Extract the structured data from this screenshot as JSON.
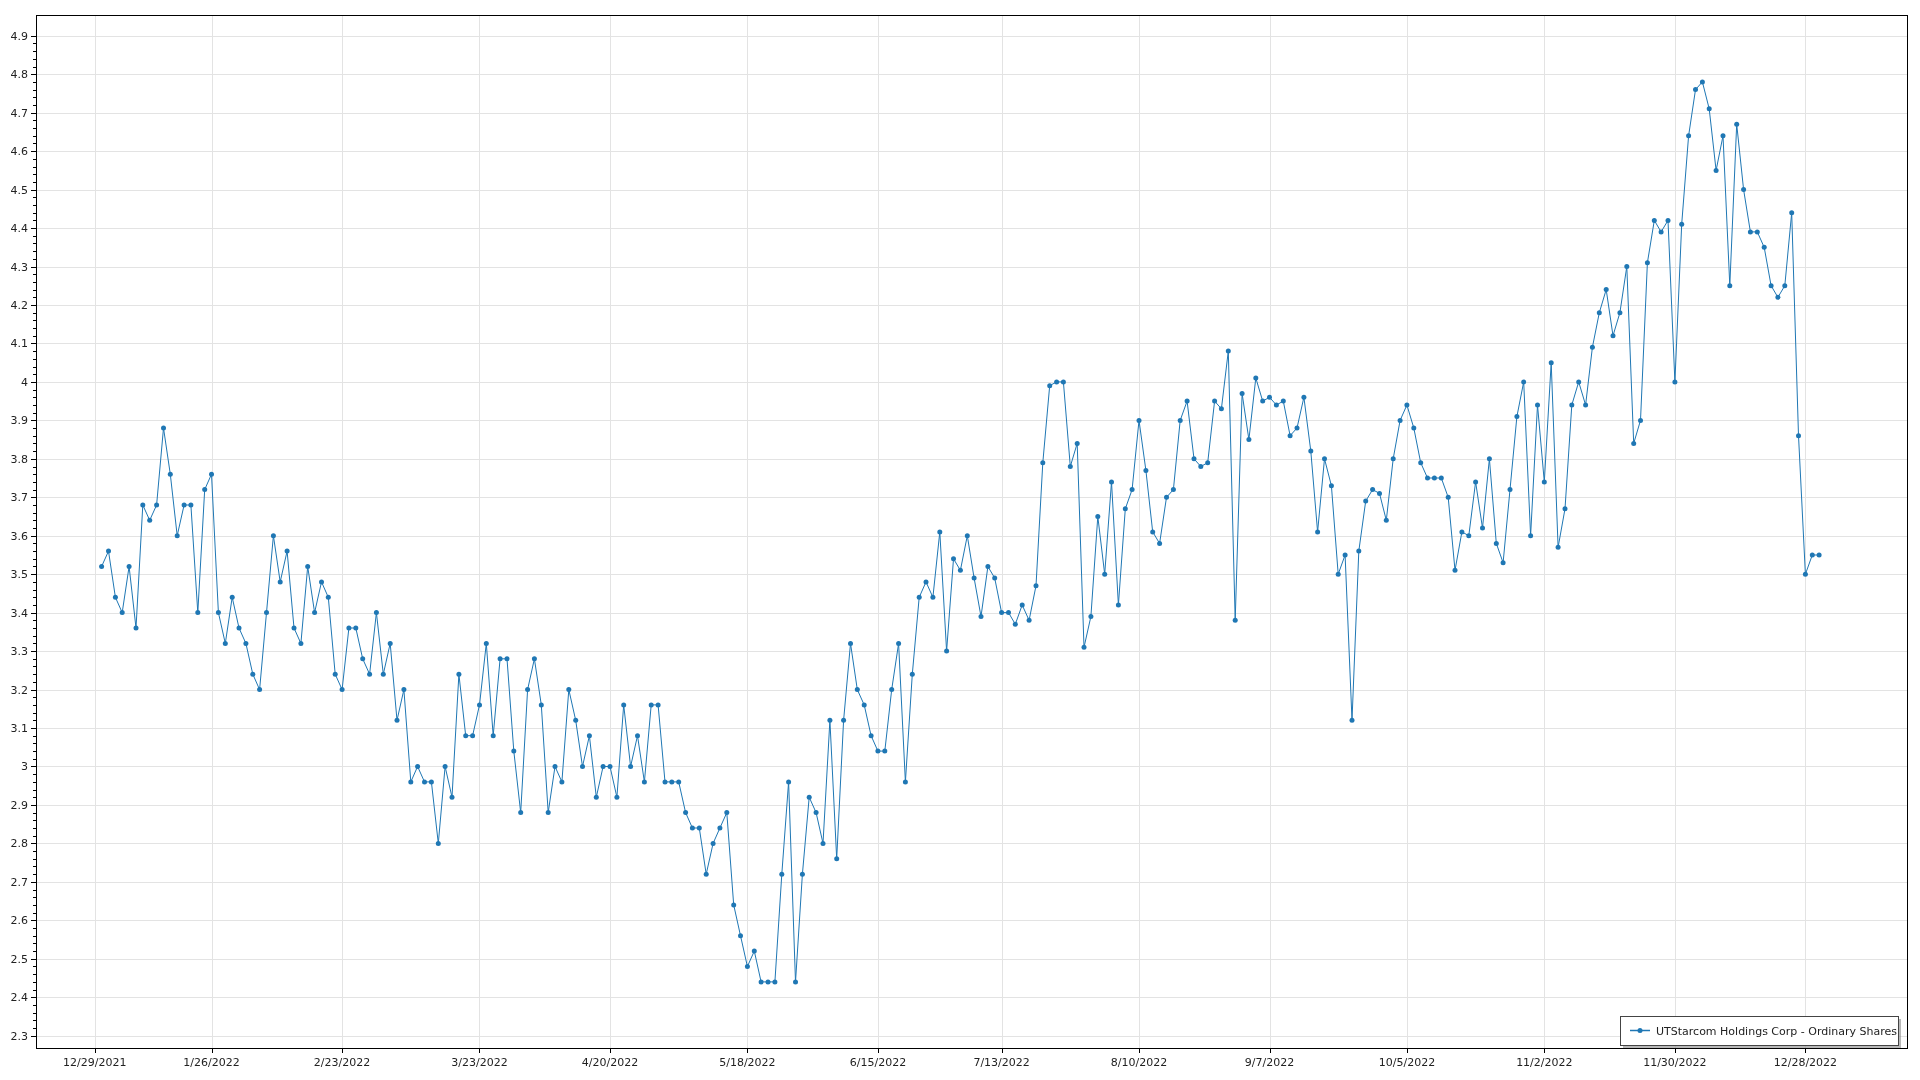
{
  "chart": {
    "chart_data": {
      "type": "line",
      "grid": true,
      "categories": [
        "12/29/2021",
        null,
        null,
        null,
        null,
        null,
        null,
        null,
        null,
        null,
        null,
        null,
        null,
        null,
        null,
        null,
        null,
        "1/26/2022",
        null,
        null,
        null,
        null,
        null,
        null,
        null,
        null,
        null,
        null,
        null,
        null,
        null,
        null,
        null,
        null,
        null,
        null,
        "2/23/2022",
        null,
        null,
        null,
        null,
        null,
        null,
        null,
        null,
        null,
        null,
        null,
        null,
        null,
        null,
        null,
        null,
        null,
        null,
        null,
        "3/23/2022",
        null,
        null,
        null,
        null,
        null,
        null,
        null,
        null,
        null,
        null,
        null,
        null,
        null,
        null,
        null,
        null,
        null,
        null,
        "4/20/2022",
        null,
        null,
        null,
        null,
        null,
        null,
        null,
        null,
        null,
        null,
        null,
        null,
        null,
        null,
        null,
        null,
        null,
        null,
        null,
        "5/18/2022",
        null,
        null,
        null,
        null,
        null,
        null,
        null,
        null,
        null,
        null,
        null,
        null,
        null,
        null,
        null,
        null,
        null,
        null,
        "6/15/2022",
        null,
        null,
        null,
        null,
        null,
        null,
        null,
        null,
        null,
        null,
        null,
        null,
        null,
        null,
        null,
        null,
        null,
        "7/13/2022",
        null,
        null,
        null,
        null,
        null,
        null,
        null,
        null,
        null,
        null,
        null,
        null,
        null,
        null,
        null,
        null,
        null,
        null,
        null,
        "8/10/2022",
        null,
        null,
        null,
        null,
        null,
        null,
        null,
        null,
        null,
        null,
        null,
        null,
        null,
        null,
        null,
        null,
        null,
        null,
        "9/7/2022",
        null,
        null,
        null,
        null,
        null,
        null,
        null,
        null,
        null,
        null,
        null,
        null,
        null,
        null,
        null,
        null,
        null,
        null,
        null,
        "10/5/2022",
        null,
        null,
        null,
        null,
        null,
        null,
        null,
        null,
        null,
        null,
        null,
        null,
        null,
        null,
        null,
        null,
        null,
        null,
        null,
        "11/2/2022",
        null,
        null,
        null,
        null,
        null,
        null,
        null,
        null,
        null,
        null,
        null,
        null,
        null,
        null,
        null,
        null,
        null,
        null,
        "11/30/2022",
        null,
        null,
        null,
        null,
        null,
        null,
        null,
        null,
        null,
        null,
        null,
        null,
        null,
        null,
        null,
        null,
        null,
        null,
        "12/28/2022",
        null,
        null
      ],
      "series": [
        {
          "name": "UTStarcom Holdings Corp - Ordinary Shares",
          "color": "#1f77b4",
          "values": [
            null,
            3.52,
            3.56,
            3.44,
            3.4,
            3.52,
            3.36,
            3.68,
            3.64,
            3.68,
            3.88,
            3.76,
            3.6,
            3.68,
            3.68,
            3.4,
            3.72,
            3.76,
            3.4,
            3.32,
            3.44,
            3.36,
            3.32,
            3.24,
            3.2,
            3.4,
            3.6,
            3.48,
            3.56,
            3.36,
            3.32,
            3.52,
            3.4,
            3.48,
            3.44,
            3.24,
            3.2,
            3.36,
            3.36,
            3.28,
            3.24,
            3.4,
            3.24,
            3.32,
            3.12,
            3.2,
            2.96,
            3.0,
            2.96,
            2.96,
            2.8,
            3.0,
            2.92,
            3.24,
            3.08,
            3.08,
            3.16,
            3.32,
            3.08,
            3.28,
            3.28,
            3.04,
            2.88,
            3.2,
            3.28,
            3.16,
            2.88,
            3.0,
            2.96,
            3.2,
            3.12,
            3.0,
            3.08,
            2.92,
            3.0,
            3.0,
            2.92,
            3.16,
            3.0,
            3.08,
            2.96,
            3.16,
            3.16,
            2.96,
            2.96,
            2.96,
            2.88,
            2.84,
            2.84,
            2.72,
            2.8,
            2.84,
            2.88,
            2.64,
            2.56,
            2.48,
            2.52,
            2.44,
            2.44,
            2.44,
            2.72,
            2.96,
            2.44,
            2.72,
            2.92,
            2.88,
            2.8,
            3.12,
            2.76,
            3.12,
            3.32,
            3.2,
            3.16,
            3.08,
            3.04,
            3.04,
            3.2,
            3.32,
            2.96,
            3.24,
            3.44,
            3.48,
            3.44,
            3.61,
            3.3,
            3.54,
            3.51,
            3.6,
            3.49,
            3.39,
            3.52,
            3.49,
            3.4,
            3.4,
            3.37,
            3.42,
            3.38,
            3.47,
            3.79,
            3.99,
            4.0,
            4.0,
            3.78,
            3.84,
            3.31,
            3.39,
            3.65,
            3.5,
            3.74,
            3.42,
            3.67,
            3.72,
            3.9,
            3.77,
            3.61,
            3.58,
            3.7,
            3.72,
            3.9,
            3.95,
            3.8,
            3.78,
            3.79,
            3.95,
            3.93,
            4.08,
            3.38,
            3.97,
            3.85,
            4.01,
            3.95,
            3.96,
            3.94,
            3.95,
            3.86,
            3.88,
            3.96,
            3.82,
            3.61,
            3.8,
            3.73,
            3.5,
            3.55,
            3.12,
            3.56,
            3.69,
            3.72,
            3.71,
            3.64,
            3.8,
            3.9,
            3.94,
            3.88,
            3.79,
            3.75,
            3.75,
            3.75,
            3.7,
            3.51,
            3.61,
            3.6,
            3.74,
            3.62,
            3.8,
            3.58,
            3.53,
            3.72,
            3.91,
            4.0,
            3.6,
            3.94,
            3.74,
            4.05,
            3.57,
            3.67,
            3.94,
            4.0,
            3.94,
            4.09,
            4.18,
            4.24,
            4.12,
            4.18,
            4.3,
            3.84,
            3.9,
            4.31,
            4.42,
            4.39,
            4.42,
            4.0,
            4.41,
            4.64,
            4.76,
            4.78,
            4.71,
            4.55,
            4.64,
            4.25,
            4.67,
            4.5,
            4.39,
            4.39,
            4.35,
            4.25,
            4.22,
            4.25,
            4.44,
            3.86,
            3.5,
            3.55,
            3.55
          ]
        }
      ],
      "ylim": [
        2.268,
        4.954
      ],
      "yticks": [
        2.3,
        2.4,
        2.5,
        2.6,
        2.7,
        2.8,
        2.9,
        3,
        3.1,
        3.2,
        3.3,
        3.4,
        3.5,
        3.6,
        3.7,
        3.8,
        3.9,
        4,
        4.1,
        4.2,
        4.3,
        4.4,
        4.5,
        4.6,
        4.7,
        4.8,
        4.9
      ]
    }
  }
}
